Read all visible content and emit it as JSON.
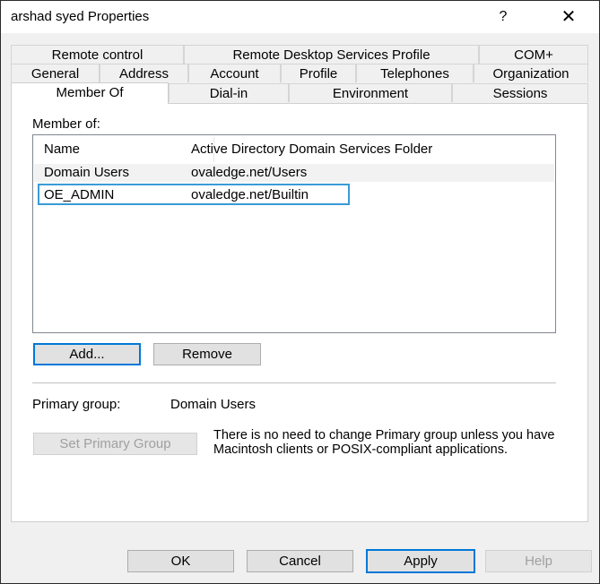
{
  "window": {
    "title": "arshad syed Properties",
    "help": "?",
    "close": "✕"
  },
  "tabs": {
    "row1": [
      "Remote control",
      "Remote Desktop Services Profile",
      "COM+"
    ],
    "row2": [
      "General",
      "Address",
      "Account",
      "Profile",
      "Telephones",
      "Organization"
    ],
    "row3": [
      "Member Of",
      "Dial-in",
      "Environment",
      "Sessions"
    ]
  },
  "member_of": {
    "label": "Member of:",
    "columns": [
      "Name",
      "Active Directory Domain Services Folder"
    ],
    "rows": [
      {
        "name": "Domain Users",
        "folder": "ovaledge.net/Users"
      },
      {
        "name": "OE_ADMIN",
        "folder": "ovaledge.net/Builtin"
      }
    ],
    "add_label": "Add...",
    "remove_label": "Remove"
  },
  "primary_group": {
    "label": "Primary group:",
    "value": "Domain Users",
    "set_button": "Set Primary Group",
    "note": "There is no need to change Primary group unless you have Macintosh clients or POSIX-compliant applications."
  },
  "footer": {
    "ok": "OK",
    "cancel": "Cancel",
    "apply": "Apply",
    "help": "Help"
  },
  "colors": {
    "selection_border": "#3a9bd6",
    "focus_border": "#0078d7",
    "dialog_bg": "#f0f0f0"
  }
}
